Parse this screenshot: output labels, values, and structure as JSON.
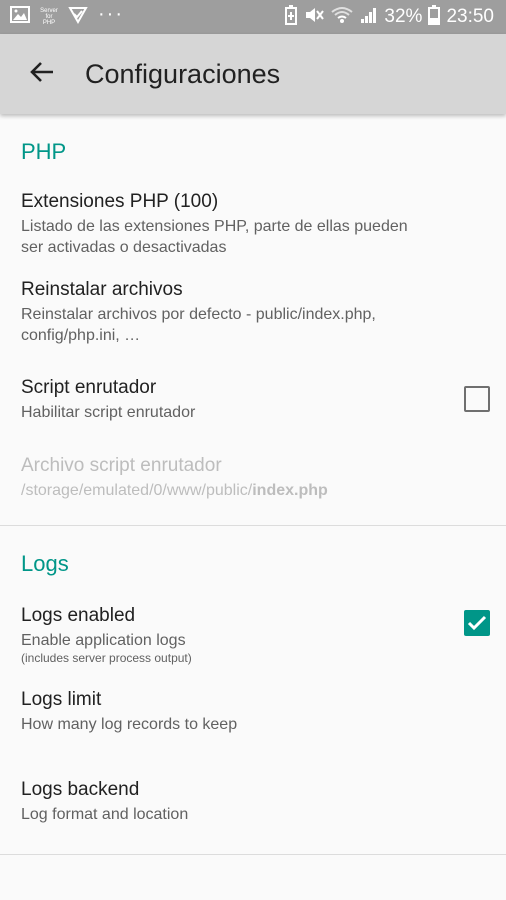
{
  "status_bar": {
    "battery_percent": "32%",
    "time": "23:50",
    "app_icon_label_top": "Server",
    "app_icon_label_mid": "for",
    "app_icon_label_bottom": "PHP",
    "more_indicator": "···"
  },
  "app_bar": {
    "title": "Configuraciones",
    "back_icon": "arrow-back-icon"
  },
  "sections": {
    "php": {
      "header": "PHP",
      "extensions": {
        "title": "Extensiones PHP (100)",
        "summary": "Listado de las extensiones PHP, parte de ellas pueden ser activadas o desactivadas"
      },
      "reinstall": {
        "title": "Reinstalar archivos",
        "summary": "Reinstalar archivos por defecto - public/index.php, config/php.ini, …"
      },
      "router_script": {
        "title": "Script enrutador",
        "summary": "Habilitar script enrutador",
        "checked": false
      },
      "router_file": {
        "title": "Archivo script enrutador",
        "summary_path": "/storage/emulated/0/www/public/",
        "summary_file": "index.php",
        "enabled": false
      }
    },
    "logs": {
      "header": "Logs",
      "enabled": {
        "title": "Logs enabled",
        "summary": "Enable application logs",
        "note": "(includes server process output)",
        "checked": true
      },
      "limit": {
        "title": "Logs limit",
        "summary": "How many log records to keep"
      },
      "backend": {
        "title": "Logs backend",
        "summary": "Log format and location"
      }
    }
  },
  "colors": {
    "accent": "#009688",
    "status_bar": "#9e9e9e",
    "app_bar": "#d6d6d6",
    "background": "#fafafa"
  }
}
